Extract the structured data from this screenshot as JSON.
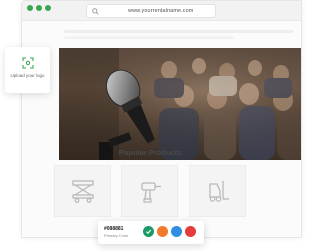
{
  "browser": {
    "url": "www.yourrentalname.com",
    "dots": [
      "#3aa54f",
      "#3aa54f",
      "#3aa54f"
    ]
  },
  "upload": {
    "label": "Upload your logo",
    "icon": "upload-logo-icon",
    "accent": "#3aa54f"
  },
  "hero": {
    "image": "conference-microphone-photo"
  },
  "products": {
    "title": "Popular Products",
    "items": [
      {
        "icon": "scissor-lift-icon"
      },
      {
        "icon": "power-drill-icon"
      },
      {
        "icon": "forklift-icon"
      }
    ]
  },
  "color_picker": {
    "hex": "#088881",
    "label": "Primary Color",
    "swatches": [
      "#1a9a66",
      "#f07a2a",
      "#2f90e3",
      "#e53b3b"
    ],
    "selected_index": 0
  }
}
